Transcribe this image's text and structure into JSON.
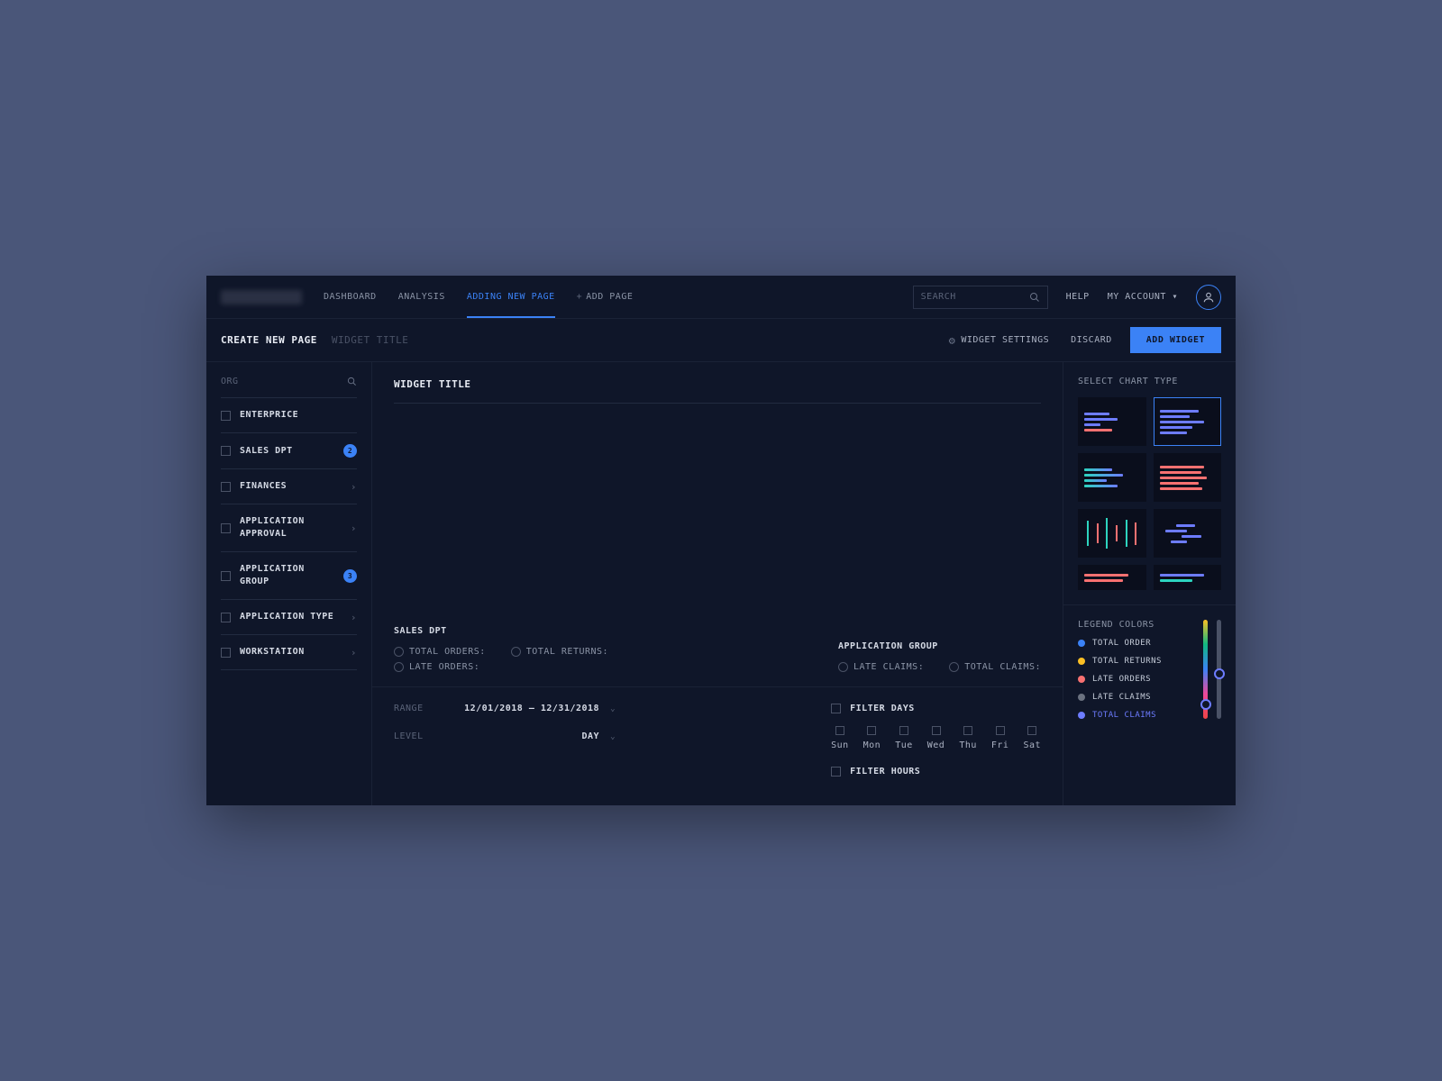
{
  "topnav": {
    "links": [
      "DASHBOARD",
      "ANALYSIS",
      "ADDING NEW PAGE",
      "ADD PAGE"
    ],
    "search_placeholder": "SEARCH",
    "help": "HELP",
    "account": "MY ACCOUNT"
  },
  "crumb": {
    "create": "CREATE NEW PAGE",
    "widget": "WIDGET TITLE",
    "settings": "WIDGET SETTINGS",
    "discard": "DISCARD",
    "add": "ADD WIDGET"
  },
  "sidebar": {
    "head": "ORG",
    "items": [
      {
        "label": "ENTERPRICE"
      },
      {
        "label": "SALES DPT",
        "badge": "2"
      },
      {
        "label": "FINANCES",
        "chev": true
      },
      {
        "label": "APPLICATION APPROVAL",
        "chev": true
      },
      {
        "label": "APPLICATION GROUP",
        "badge": "3"
      },
      {
        "label": "APPLICATION TYPE",
        "chev": true
      },
      {
        "label": "WORKSTATION",
        "chev": true
      }
    ]
  },
  "widget_title": "WIDGET TITLE",
  "axis": {
    "left": {
      "title": "SALES DPT",
      "opts": [
        "TOTAL ORDERS:",
        "TOTAL RETURNS:",
        "LATE ORDERS:"
      ]
    },
    "right": {
      "title": "APPLICATION GROUP",
      "opts": [
        "LATE CLAIMS:",
        "TOTAL CLAIMS:"
      ]
    }
  },
  "controls": {
    "range_label": "RANGE",
    "range_value": "12/01/2018 – 12/31/2018",
    "level_label": "LEVEL",
    "level_value": "DAY",
    "filter_days": "FILTER DAYS",
    "days": [
      "Sun",
      "Mon",
      "Tue",
      "Wed",
      "Thu",
      "Fri",
      "Sat"
    ],
    "filter_hours": "FILTER HOURS"
  },
  "rightpane": {
    "select_title": "SELECT CHART TYPE",
    "legend_title": "LEGEND COLORS",
    "legend": [
      {
        "label": "TOTAL ORDER",
        "color": "#3b82f6"
      },
      {
        "label": "TOTAL RETURNS",
        "color": "#fbbf24"
      },
      {
        "label": "LATE ORDERS",
        "color": "#f87171"
      },
      {
        "label": "LATE CLAIMS",
        "color": "#6b7280"
      },
      {
        "label": "TOTAL CLAIMS",
        "color": "#6d7cff",
        "active": true
      }
    ]
  }
}
